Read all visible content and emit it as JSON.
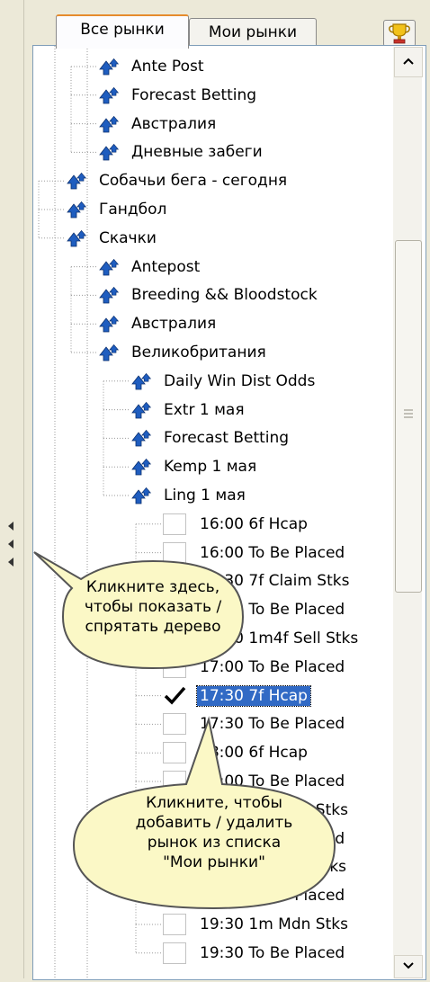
{
  "tabs": [
    {
      "label": "Все рынки",
      "active": true
    },
    {
      "label": "Мои рынки",
      "active": false
    }
  ],
  "trophy_icon": "trophy-icon",
  "accent_tab_color": "#e68b2c",
  "selection_color": "#316ac5",
  "tree": {
    "nodes": [
      {
        "label": "Ante Post",
        "type": "folder"
      },
      {
        "label": "Forecast Betting",
        "type": "folder"
      },
      {
        "label": "Австралия",
        "type": "folder"
      },
      {
        "label": "Дневные забеги",
        "type": "folder"
      },
      {
        "label": "Собачьи бега - сегодня",
        "type": "folder"
      },
      {
        "label": "Гандбол",
        "type": "folder"
      },
      {
        "label": "Скачки",
        "type": "folder"
      },
      {
        "label": "Antepost",
        "type": "folder"
      },
      {
        "label": "Breeding && Bloodstock",
        "type": "folder"
      },
      {
        "label": "Австралия",
        "type": "folder"
      },
      {
        "label": "Великобритания",
        "type": "folder"
      },
      {
        "label": "Daily Win Dist Odds",
        "type": "folder"
      },
      {
        "label": "Extr 1 мая",
        "type": "folder"
      },
      {
        "label": "Forecast Betting",
        "type": "folder"
      },
      {
        "label": "Kemp 1 мая",
        "type": "folder"
      },
      {
        "label": "Ling 1 мая",
        "type": "folder"
      },
      {
        "label": "16:00 6f Hcap",
        "type": "market",
        "checked": false
      },
      {
        "label": "16:00 To Be Placed",
        "type": "market",
        "checked": false
      },
      {
        "label": "16:30 7f Claim Stks",
        "type": "market",
        "checked": false
      },
      {
        "label": "16:30 To Be Placed",
        "type": "market",
        "checked": false
      },
      {
        "label": "17:00 1m4f Sell Stks",
        "type": "market",
        "checked": false
      },
      {
        "label": "17:00 To Be Placed",
        "type": "market",
        "checked": false
      },
      {
        "label": "17:30 7f Hcap",
        "type": "market",
        "checked": true,
        "selected": true
      },
      {
        "label": "17:30 To Be Placed",
        "type": "market",
        "checked": false
      },
      {
        "label": "18:00 6f Hcap",
        "type": "market",
        "checked": false
      },
      {
        "label": "18:00 To Be Placed",
        "type": "market",
        "checked": false
      },
      {
        "label": "18:30 1m Mdn Stks",
        "type": "market",
        "checked": false
      },
      {
        "label": "18:30 To Be Placed",
        "type": "market",
        "checked": false
      },
      {
        "label": "19:00 1m Mdn stks",
        "type": "market",
        "checked": false
      },
      {
        "label": "19:00 To Be Placed",
        "type": "market",
        "checked": false
      },
      {
        "label": "19:30 1m Mdn Stks",
        "type": "market",
        "checked": false
      },
      {
        "label": "19:30 To Be Placed",
        "type": "market",
        "checked": false
      }
    ]
  },
  "callouts": [
    {
      "text": "Кликните здесь,\nчтобы показать /\nспрятать дерево"
    },
    {
      "text": "Кликните, чтобы\nдобавить / удалить\nрынок из списка\n\"Мои рынки\""
    }
  ]
}
